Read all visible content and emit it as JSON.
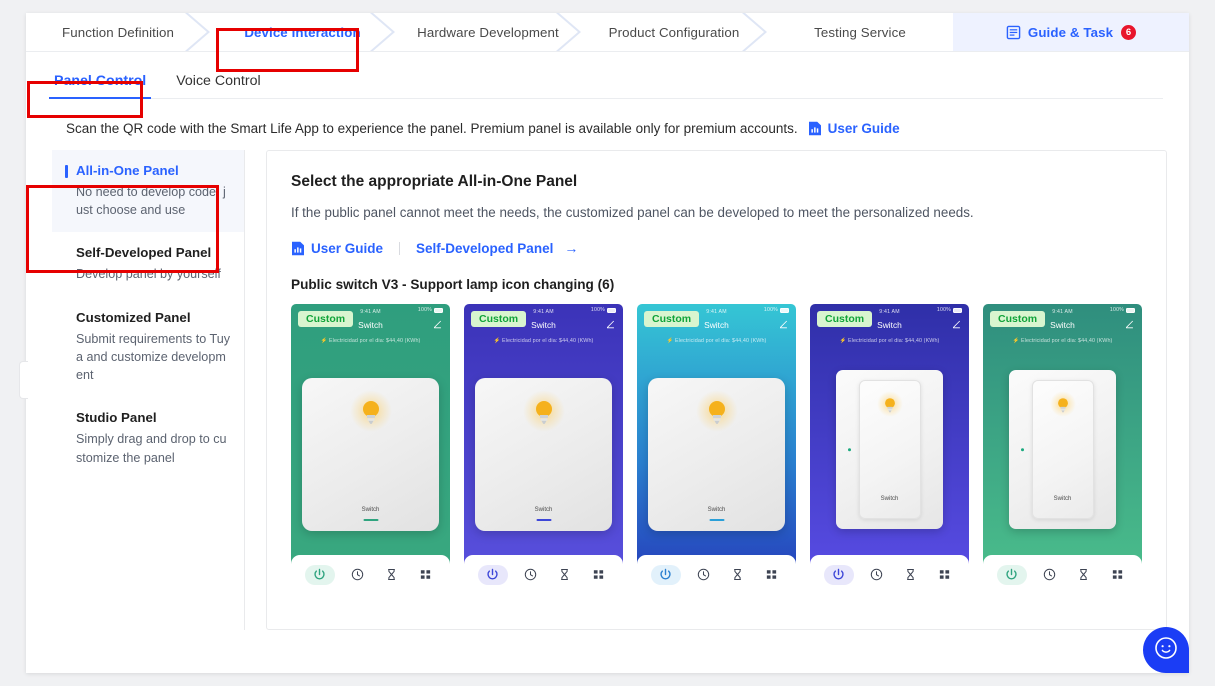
{
  "stepnav": {
    "steps": [
      {
        "label": "Function Definition",
        "active": false
      },
      {
        "label": "Device Interaction",
        "active": true
      },
      {
        "label": "Hardware Development",
        "active": false
      },
      {
        "label": "Product Configuration",
        "active": false
      },
      {
        "label": "Testing Service",
        "active": false
      }
    ],
    "guide_task": {
      "label": "Guide & Task",
      "badge": "6",
      "icon": "document-list-icon"
    }
  },
  "subtabs": [
    {
      "label": "Panel Control",
      "active": true
    },
    {
      "label": "Voice Control",
      "active": false
    }
  ],
  "description": {
    "text": "Scan the QR code with the Smart Life App to experience the panel. Premium panel is available only for premium accounts.",
    "link_label": "User Guide",
    "link_icon": "document-chart-icon"
  },
  "sidebar": {
    "items": [
      {
        "title": "All-in-One Panel",
        "desc": "No need to develop code, just choose and use",
        "active": true
      },
      {
        "title": "Self-Developed Panel",
        "desc": "Develop panel by yourself",
        "active": false
      },
      {
        "title": "Customized Panel",
        "desc": "Submit requirements to Tuya and customize development",
        "active": false
      },
      {
        "title": "Studio Panel",
        "desc": "Simply drag and drop to customize the panel",
        "active": false
      }
    ]
  },
  "content": {
    "title": "Select the appropriate All-in-One Panel",
    "subtitle": "If the public panel cannot meet the needs, the customized panel can be developed to meet the personalized needs.",
    "links": [
      {
        "label": "User Guide",
        "icon": "document-chart-icon",
        "arrow": ""
      },
      {
        "label": "Self-Developed Panel",
        "icon": "",
        "arrow": "→"
      }
    ],
    "gallery_title": "Public switch V3 - Support lamp icon changing (6)",
    "cards": [
      {
        "badge": "Custom",
        "time": "9:41 AM",
        "battery": "100%",
        "title": "Switch",
        "electricity": "Electricidad por el dia: $44,40 (KWh)",
        "switch_label": "Switch",
        "style": "flat",
        "bg_from": "#2f9e7e",
        "bg_to": "#3aa97f",
        "accent": "#2fa47f",
        "edit_icon": "edit-pencil-icon",
        "tools": [
          "power-icon",
          "clock-icon",
          "hourglass-icon",
          "grid-icon"
        ]
      },
      {
        "badge": "Custom",
        "time": "9:41 AM",
        "battery": "100%",
        "title": "Switch",
        "electricity": "Electricidad por el dia: $44,40 (KWh)",
        "switch_label": "Switch",
        "style": "flat",
        "bg_from": "#3b33b8",
        "bg_to": "#5b52e0",
        "accent": "#3d46d8",
        "edit_icon": "edit-pencil-icon",
        "tools": [
          "power-icon",
          "clock-icon",
          "hourglass-icon",
          "grid-icon"
        ]
      },
      {
        "badge": "Custom",
        "time": "9:41 AM",
        "battery": "100%",
        "title": "Switch",
        "electricity": "Electricidad por el dia: $44,40 (KWh)",
        "switch_label": "Switch",
        "style": "flat",
        "bg_from": "#35c6d4",
        "bg_to": "#2536b8",
        "accent": "#2a9fd8",
        "edit_icon": "edit-pencil-icon",
        "tools": [
          "power-icon",
          "clock-icon",
          "hourglass-icon",
          "grid-icon"
        ]
      },
      {
        "badge": "Custom",
        "time": "9:41 AM",
        "battery": "100%",
        "title": "Switch",
        "electricity": "Electricidad por el dia: $44,40 (KWh)",
        "switch_label": "Switch",
        "style": "rocker",
        "bg_from": "#2f2fa8",
        "bg_to": "#5b4ee8",
        "accent": "#3d46d8",
        "edit_icon": "edit-pencil-icon",
        "tools": [
          "power-icon",
          "clock-icon",
          "hourglass-icon",
          "grid-icon"
        ]
      },
      {
        "badge": "Custom",
        "time": "9:41 AM",
        "battery": "100%",
        "title": "Switch",
        "electricity": "Electricidad por el dia: $44,40 (KWh)",
        "switch_label": "Switch",
        "style": "rocker",
        "bg_from": "#2f8e7e",
        "bg_to": "#4cc08c",
        "accent": "#2fa47f",
        "edit_icon": "edit-pencil-icon",
        "tools": [
          "power-icon",
          "clock-icon",
          "hourglass-icon",
          "grid-icon"
        ]
      }
    ]
  },
  "fab": {
    "icon": "support-smiley-icon"
  },
  "colors": {
    "accent_blue": "#2a62ff",
    "badge_red": "#e8152c",
    "annotation_red": "#e60000"
  }
}
